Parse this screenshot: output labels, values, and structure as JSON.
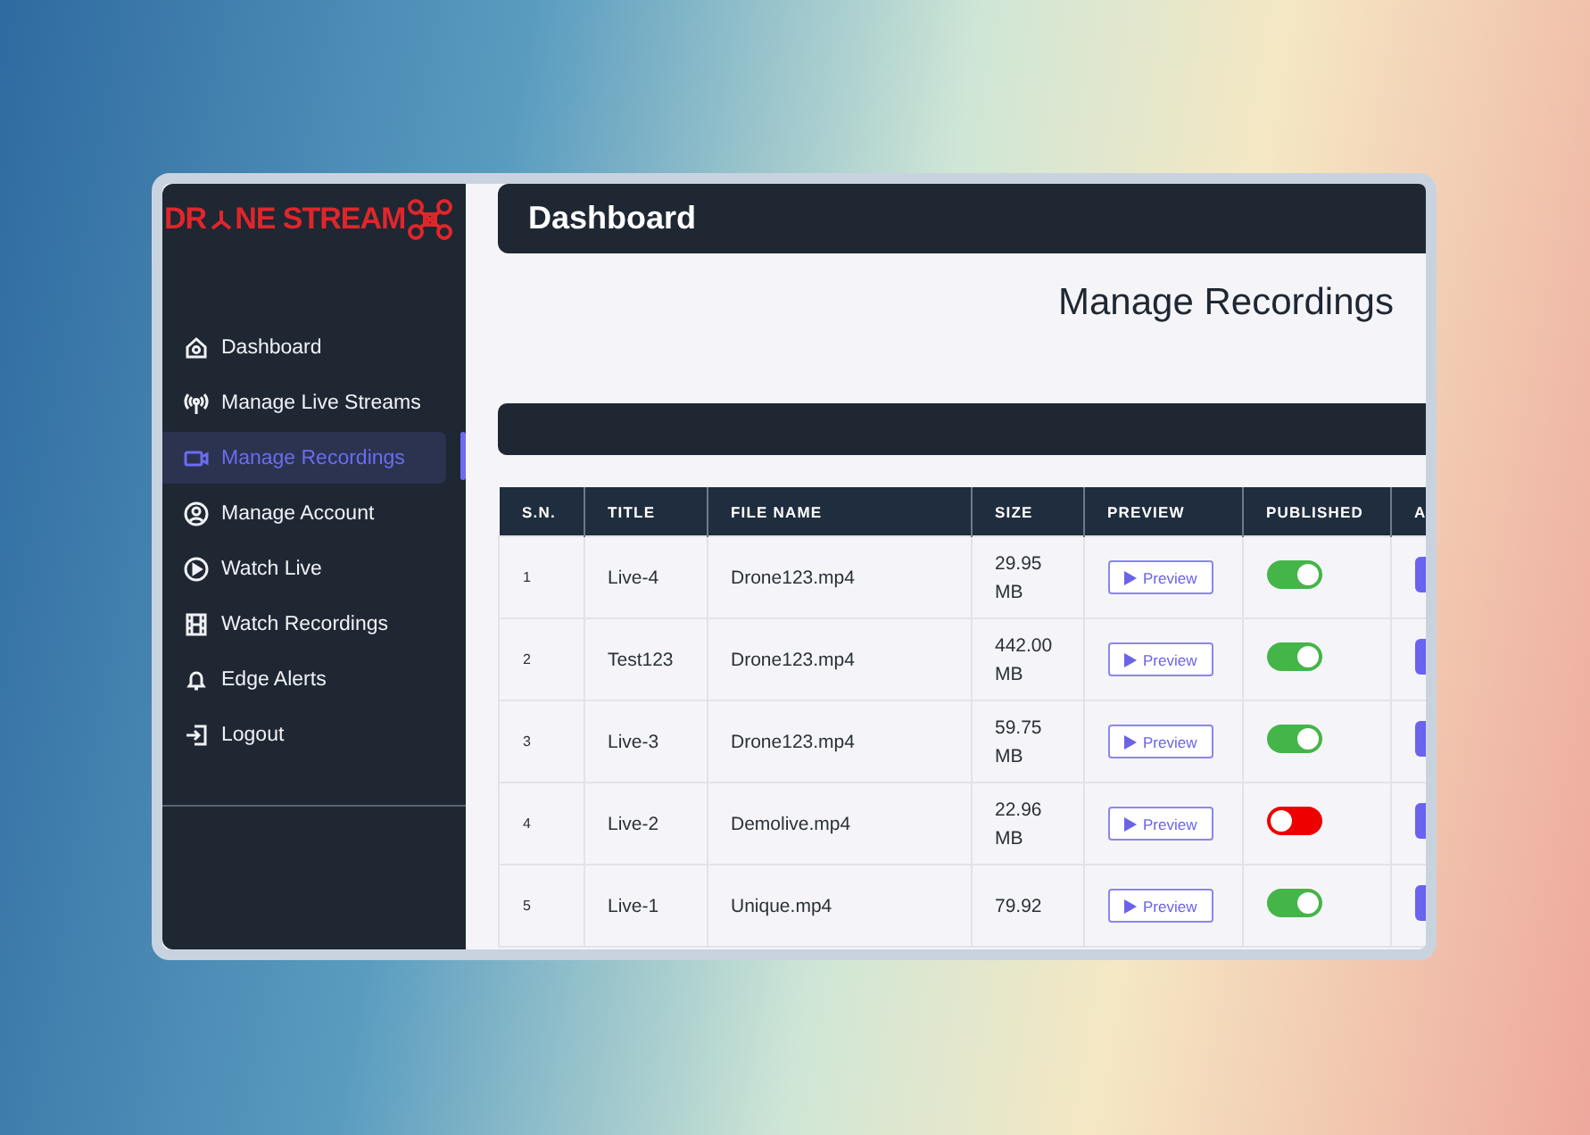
{
  "logo": {
    "text_before": "DR",
    "text_after": "NE STREAM"
  },
  "sidebar": {
    "items": [
      {
        "label": "Dashboard",
        "selected": false
      },
      {
        "label": "Manage Live Streams",
        "selected": false
      },
      {
        "label": "Manage Recordings",
        "selected": true
      },
      {
        "label": "Manage Account",
        "selected": false
      },
      {
        "label": "Watch Live",
        "selected": false
      },
      {
        "label": "Watch Recordings",
        "selected": false
      },
      {
        "label": "Edge Alerts",
        "selected": false
      },
      {
        "label": "Logout",
        "selected": false
      }
    ]
  },
  "header": {
    "title": "Dashboard"
  },
  "page_title": "Manage Recordings",
  "table": {
    "columns": [
      "S.N.",
      "TITLE",
      "FILE NAME",
      "SIZE",
      "PREVIEW",
      "PUBLISHED",
      "A"
    ],
    "rows": [
      {
        "sn": "1",
        "title": "Live-4",
        "file_name": "Drone123.mp4",
        "size": [
          "29.95",
          "MB"
        ],
        "preview": "Preview",
        "published": true
      },
      {
        "sn": "2",
        "title": "Test123",
        "file_name": "Drone123.mp4",
        "size": [
          "442.00",
          "MB"
        ],
        "preview": "Preview",
        "published": true
      },
      {
        "sn": "3",
        "title": "Live-3",
        "file_name": "Drone123.mp4",
        "size": [
          "59.75",
          "MB"
        ],
        "preview": "Preview",
        "published": true
      },
      {
        "sn": "4",
        "title": "Live-2",
        "file_name": "Demolive.mp4",
        "size": [
          "22.96",
          "MB"
        ],
        "preview": "Preview",
        "published": false
      },
      {
        "sn": "5",
        "title": "Live-1",
        "file_name": "Unique.mp4",
        "size": [
          "79.92"
        ],
        "preview": "Preview",
        "published": true
      }
    ]
  }
}
